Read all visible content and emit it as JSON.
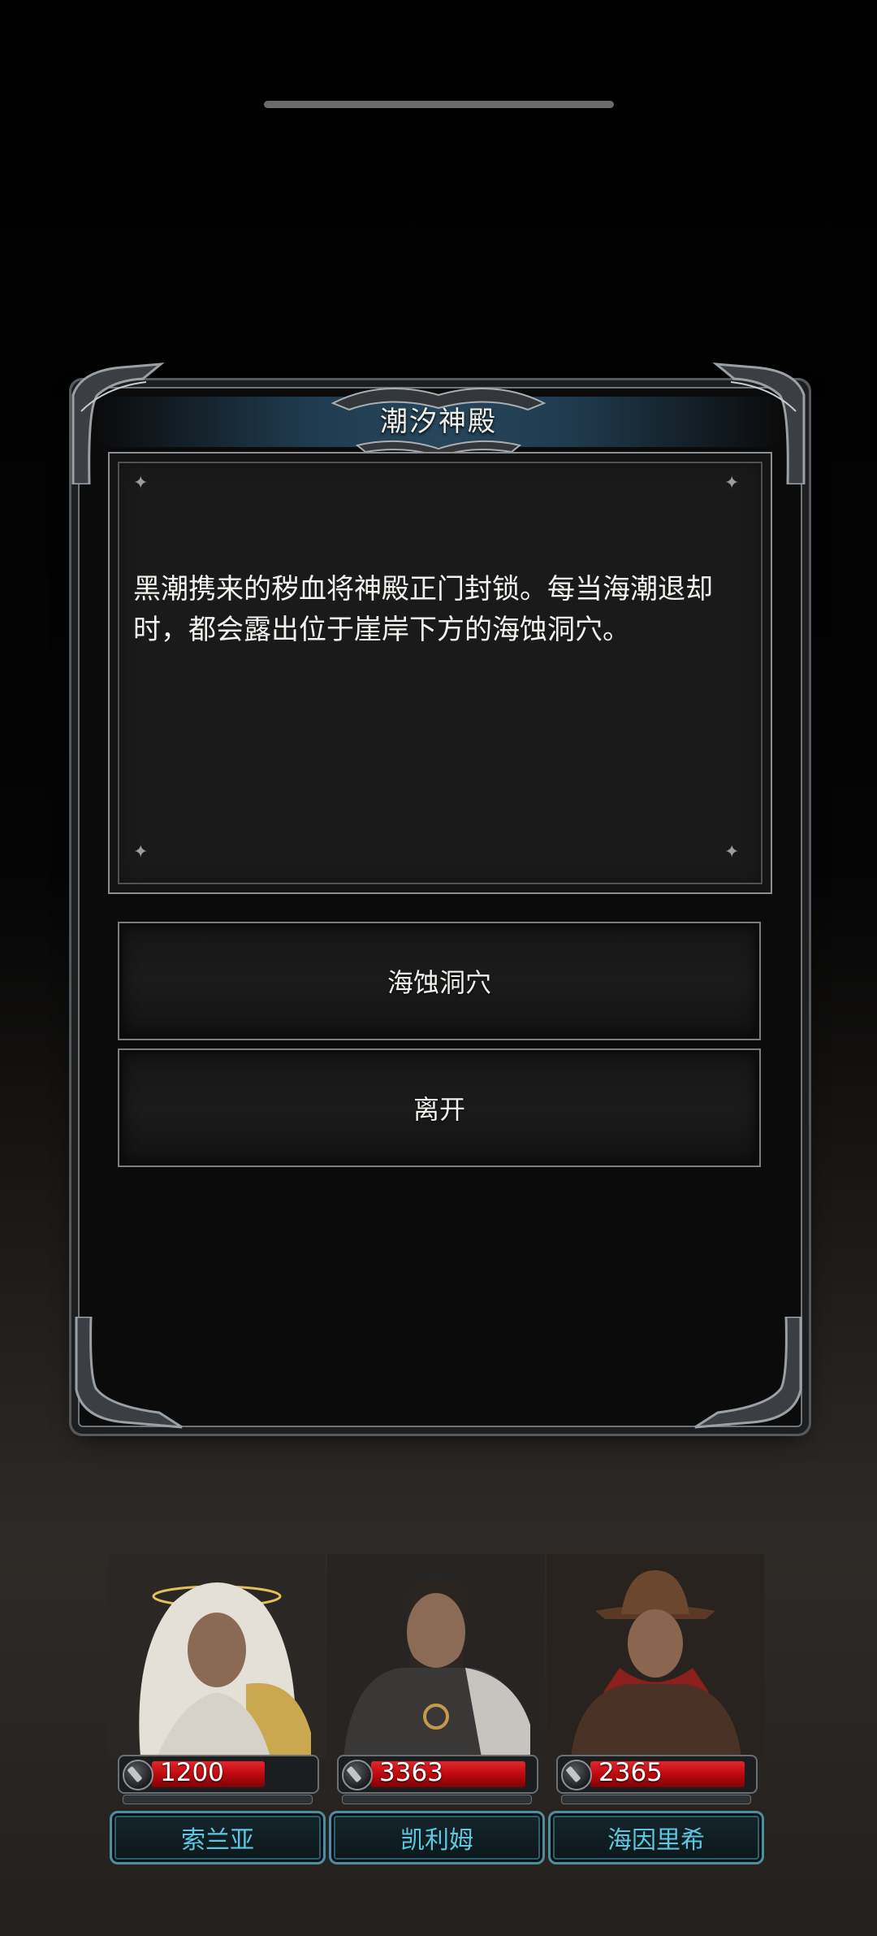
{
  "dialog": {
    "title": "潮汐神殿",
    "description": "黑潮携来的秽血将神殿正门封锁。每当海潮退却时，都会露出位于崖岸下方的海蚀洞穴。",
    "choices": [
      {
        "label": "海蚀洞穴"
      },
      {
        "label": "离开"
      }
    ]
  },
  "party": [
    {
      "name": "索兰亚",
      "hp": "1200",
      "hp_fill": 0.7
    },
    {
      "name": "凯利姆",
      "hp": "3363",
      "hp_fill": 0.96
    },
    {
      "name": "海因里希",
      "hp": "2365",
      "hp_fill": 0.96
    }
  ],
  "colors": {
    "accent_teal": "#5fc6e0",
    "hp_red": "#c8080e",
    "title_bar": "#27465c"
  }
}
